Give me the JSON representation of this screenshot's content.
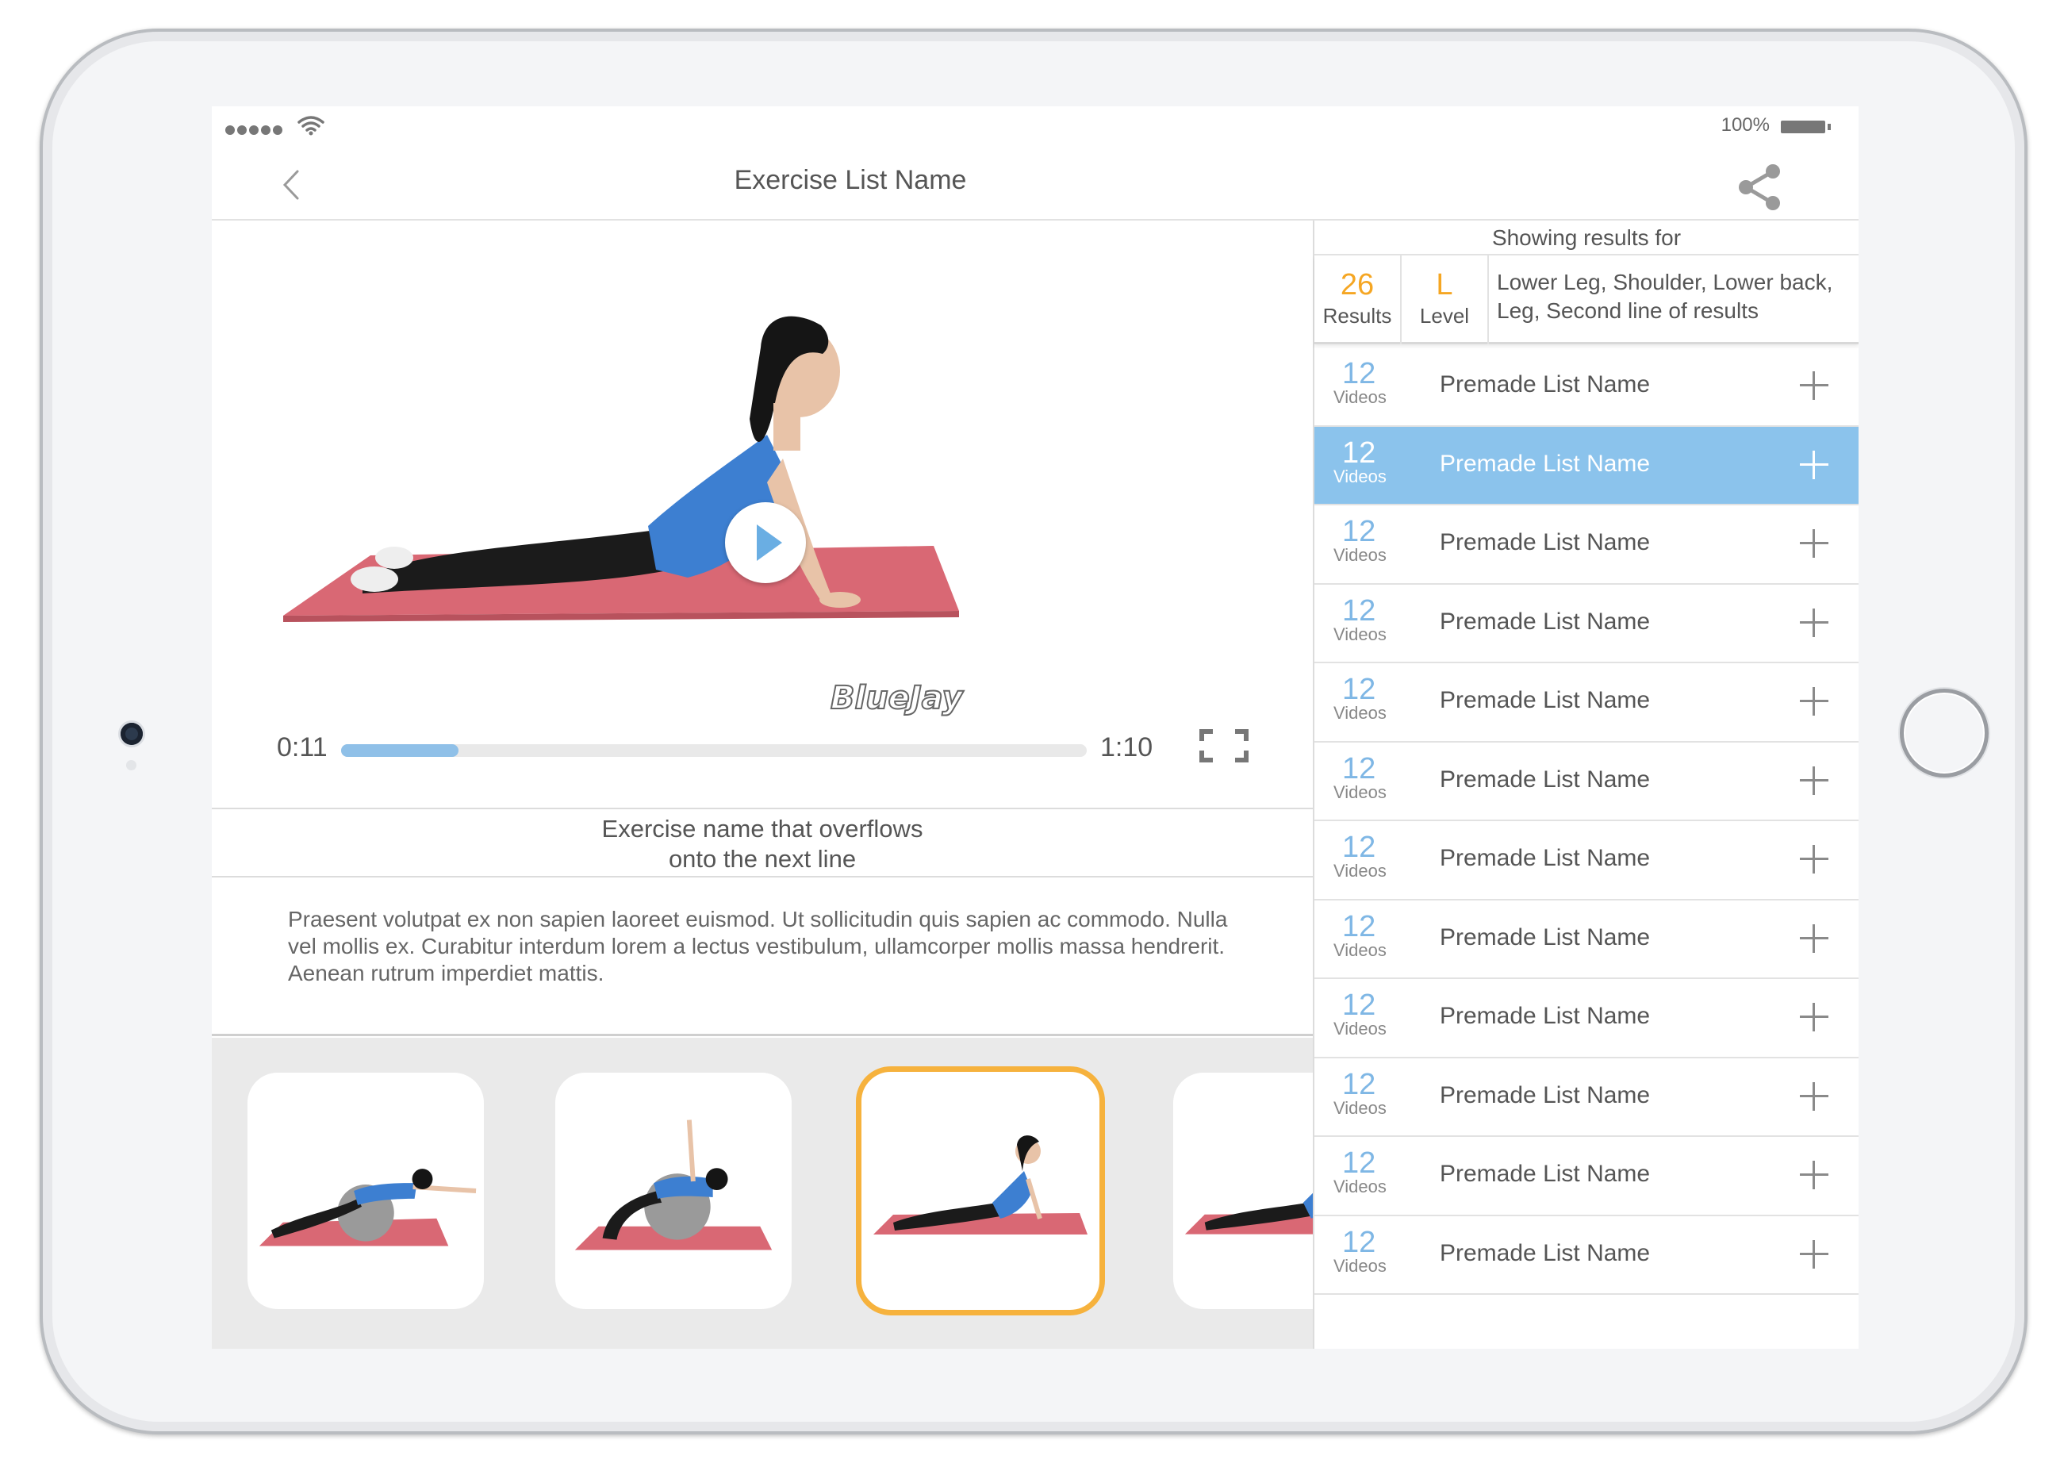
{
  "status_bar": {
    "battery_percent": "100%"
  },
  "nav": {
    "title": "Exercise List Name"
  },
  "video": {
    "watermark": "BlueJay",
    "current_time": "0:11",
    "total_time": "1:10",
    "progress_fraction": 0.157
  },
  "exercise": {
    "name_line1": "Exercise name that overflows",
    "name_line2": "onto the next line",
    "description": "Praesent volutpat ex non sapien laoreet euismod. Ut sollicitudin quis sapien ac commodo. Nulla vel mollis ex. Curabitur interdum lorem a lectus vestibulum, ullamcorper mollis massa hendrerit. Aenean rutrum imperdiet mattis."
  },
  "thumbnails": [
    {
      "pose": "ball-extension",
      "selected": false
    },
    {
      "pose": "ball-reach",
      "selected": false
    },
    {
      "pose": "cobra",
      "selected": true
    },
    {
      "pose": "cobra-partial",
      "selected": false
    }
  ],
  "results": {
    "heading": "Showing results for",
    "count": "26",
    "count_label": "Results",
    "level": "L",
    "level_label": "Level",
    "filters": "Lower Leg, Shoulder, Lower back, Leg, Second line of results"
  },
  "lists": [
    {
      "count": "12",
      "unit": "Videos",
      "name": "Premade List Name",
      "highlighted": false
    },
    {
      "count": "12",
      "unit": "Videos",
      "name": "Premade List Name",
      "highlighted": true
    },
    {
      "count": "12",
      "unit": "Videos",
      "name": "Premade List Name",
      "highlighted": false
    },
    {
      "count": "12",
      "unit": "Videos",
      "name": "Premade List Name",
      "highlighted": false
    },
    {
      "count": "12",
      "unit": "Videos",
      "name": "Premade List Name",
      "highlighted": false
    },
    {
      "count": "12",
      "unit": "Videos",
      "name": "Premade List Name",
      "highlighted": false
    },
    {
      "count": "12",
      "unit": "Videos",
      "name": "Premade List Name",
      "highlighted": false
    },
    {
      "count": "12",
      "unit": "Videos",
      "name": "Premade List Name",
      "highlighted": false
    },
    {
      "count": "12",
      "unit": "Videos",
      "name": "Premade List Name",
      "highlighted": false
    },
    {
      "count": "12",
      "unit": "Videos",
      "name": "Premade List Name",
      "highlighted": false
    },
    {
      "count": "12",
      "unit": "Videos",
      "name": "Premade List Name",
      "highlighted": false
    },
    {
      "count": "12",
      "unit": "Videos",
      "name": "Premade List Name",
      "highlighted": false
    }
  ],
  "colors": {
    "accent_blue": "#8bc3ec",
    "accent_orange": "#f5a623",
    "selected_border": "#f6b23d"
  }
}
